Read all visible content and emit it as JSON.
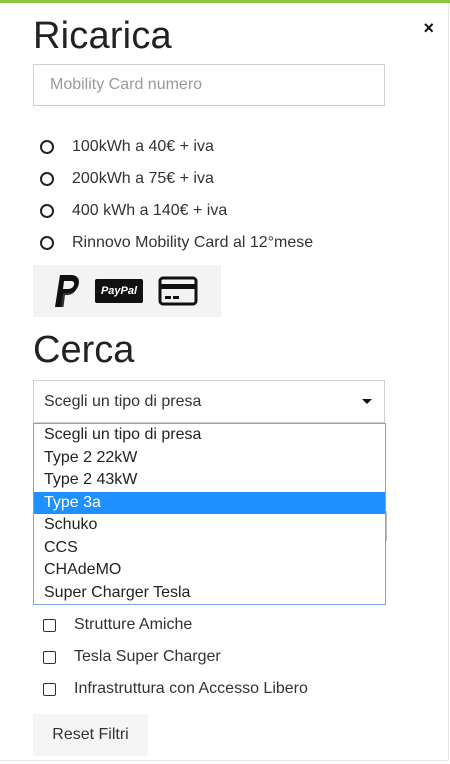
{
  "header": {
    "title": "Ricarica",
    "close_symbol": "×"
  },
  "recharge": {
    "card_input": {
      "placeholder": "Mobility Card numero",
      "value": ""
    },
    "options": [
      {
        "label": "100kWh a 40€ + iva"
      },
      {
        "label": "200kWh a 75€ + iva"
      },
      {
        "label": "400 kWh a 140€ + iva"
      },
      {
        "label": "Rinnovo Mobility Card al 12°mese"
      }
    ],
    "payment": {
      "icons": [
        "paypal-p-icon",
        "paypal-wordmark-icon",
        "credit-card-icon"
      ],
      "paypal_text": "PayPal"
    }
  },
  "search": {
    "title": "Cerca",
    "select": {
      "selected_label": "Scegli un tipo di presa",
      "options": [
        "Scegli un tipo di presa",
        "Type 2 22kW",
        "Type 2 43kW",
        "Type 3a",
        "Schuko",
        "CCS",
        "CHAdeMO",
        "Super Charger Tesla"
      ],
      "highlighted_option": "Type 3a"
    },
    "filters": [
      {
        "label": "Strutture Amiche",
        "checked": false
      },
      {
        "label": "Tesla Super Charger",
        "checked": false
      },
      {
        "label": "Infrastruttura con Accesso Libero",
        "checked": false
      }
    ],
    "reset_label": "Reset Filtri"
  },
  "colors": {
    "accent_top_bar": "#8cc63f",
    "dropdown_highlight": "#1e90ff"
  }
}
